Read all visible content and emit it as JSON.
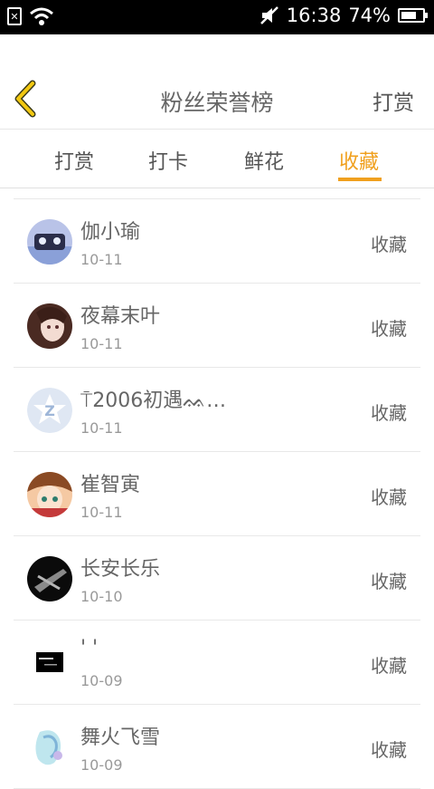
{
  "status_bar": {
    "time": "16:38",
    "battery_percent": "74%",
    "battery_level": 0.74
  },
  "header": {
    "title": "粉丝荣誉榜",
    "right_action": "打赏",
    "back_icon": "chevron-left-icon"
  },
  "tabs": [
    {
      "label": "打赏"
    },
    {
      "label": "打卡"
    },
    {
      "label": "鲜花"
    },
    {
      "label": "收藏"
    }
  ],
  "active_tab": "收藏",
  "colors": {
    "accent": "#f0a01e",
    "text": "#666666",
    "muted": "#999999",
    "divider": "#e8e8e8"
  },
  "fans": [
    {
      "name": "伽小瑜",
      "date": "10-11",
      "action": "收藏"
    },
    {
      "name": "⍑2006初遇ᨐ…",
      "date": "10-11",
      "action": "收藏"
    },
    {
      "name": "夜幕末叶",
      "date": "10-11",
      "action": "收藏"
    },
    {
      "name": "崔智寅",
      "date": "10-11",
      "action": "收藏"
    },
    {
      "name": "长安长乐",
      "date": "10-10",
      "action": "收藏"
    },
    {
      "name": "' '",
      "date": "10-09",
      "action": "收藏"
    },
    {
      "name": "舞火飞雪",
      "date": "10-09",
      "action": "收藏"
    }
  ]
}
